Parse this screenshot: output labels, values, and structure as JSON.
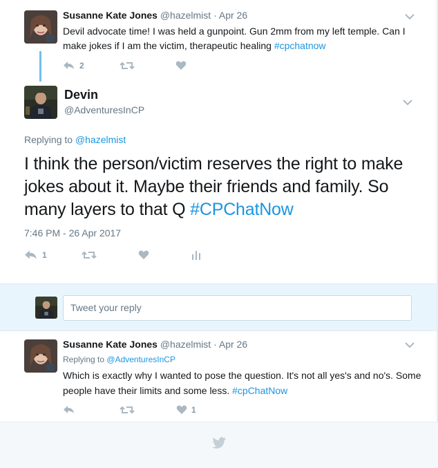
{
  "parent_tweet": {
    "name": "Susanne Kate Jones",
    "handle": "@hazelmist",
    "date": "Apr 26",
    "text": "Devil advocate time! I was held a gunpoint. Gun 2mm from my left temple. Can I make jokes if I am the victim, therapeutic healing",
    "hashtag": "#cpchatnow",
    "reply_count": "2"
  },
  "main_tweet": {
    "name": "Devin",
    "handle": "@AdventuresInCP",
    "replying_prefix": "Replying to",
    "replying_to": "@hazelmist",
    "text": "I think the person/victim reserves the right to make jokes about it. Maybe their friends and family. So many layers to that Q",
    "hashtag": "#CPChatNow",
    "timestamp": "7:46 PM - 26 Apr 2017",
    "reply_count": "1"
  },
  "reply_box": {
    "placeholder": "Tweet your reply"
  },
  "reply_tweet": {
    "name": "Susanne Kate Jones",
    "handle": "@hazelmist",
    "date": "Apr 26",
    "replying_prefix": "Replying to",
    "replying_to": "@AdventuresInCP",
    "text": "Which is exactly why I wanted to pose the question. It's not all yes's and no's. Some people have their limits and some less.",
    "hashtag": "#cpChatNow",
    "like_count": "1"
  },
  "icons": [
    "reply-icon",
    "retweet-icon",
    "like-icon",
    "analytics-icon",
    "chevron-down-icon",
    "twitter-bird-icon"
  ],
  "colors": {
    "link_blue": "#1b95e0",
    "thread_line": "#73bff0",
    "reply_bg": "#e8f5fd",
    "action_grey": "#8899a6"
  }
}
